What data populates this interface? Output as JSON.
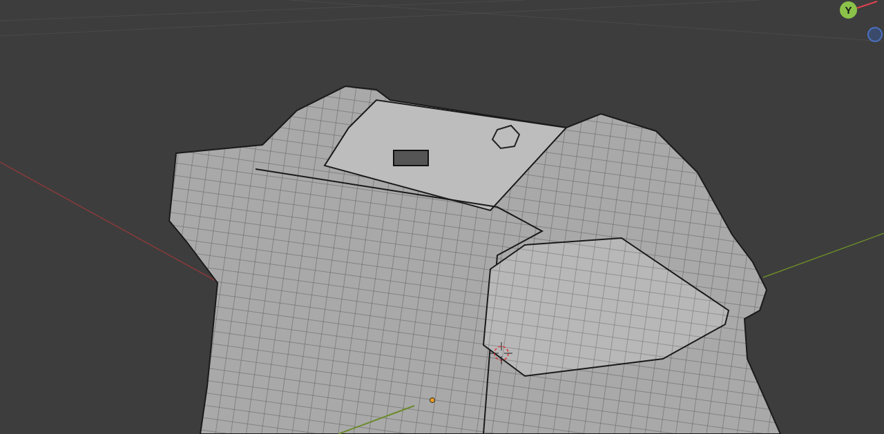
{
  "viewport": {
    "navigation_gizmo": {
      "axes": [
        {
          "label": "Y"
        }
      ]
    }
  }
}
